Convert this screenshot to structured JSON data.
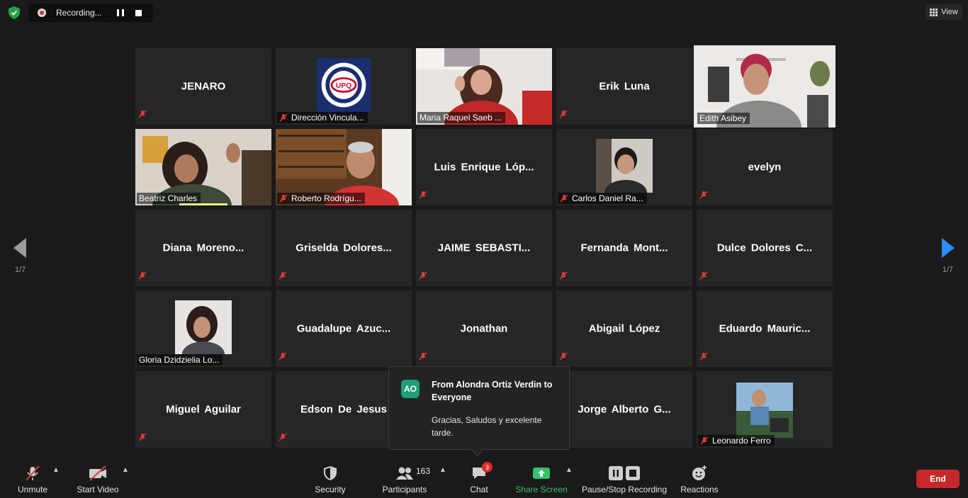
{
  "recording": {
    "label": "Recording..."
  },
  "view": {
    "label": "View"
  },
  "pagination": {
    "left": "1/7",
    "right": "1/7"
  },
  "participants": {
    "jenaro": "JENARO",
    "direccion": "Dirección Vincula...",
    "maria": "Maria Raquel Saeb ...",
    "erik": "Erik Luna",
    "edith": "Edith Asibey",
    "beatriz": "Beatriz Charles",
    "roberto": "Roberto Rodrígu...",
    "luis": "Luis Enrique Lóp...",
    "carlos": "Carlos Daniel Ra...",
    "evelyn": "evelyn",
    "diana": "Diana Moreno...",
    "griselda": "Griselda Dolores...",
    "jaime": "JAIME SEBASTI...",
    "fernanda": "Fernanda Mont...",
    "dulce": "Dulce Dolores C...",
    "gloria": "Gloria Dzidzielia Lo...",
    "guadalupe": "Guadalupe Azuc...",
    "jonathan": "Jonathan",
    "abigail": "Abigail López",
    "eduardo": "Eduardo Mauric...",
    "miguel": "Miguel Aguilar",
    "edson": "Edson De Jesus",
    "jorge": "Jorge Alberto G...",
    "leonardo": "Leonardo Ferro"
  },
  "logo": {
    "text": "UPQ"
  },
  "chat_popup": {
    "avatar": "AO",
    "from": "From Alondra Ortiz Verdin to Everyone",
    "message": "Gracias, Saludos y excelente tarde."
  },
  "toolbar": {
    "unmute": "Unmute",
    "start_video": "Start Video",
    "security": "Security",
    "participants": "Participants",
    "participant_count": "163",
    "chat": "Chat",
    "chat_badge": "3",
    "share_screen": "Share Screen",
    "pause_stop": "Pause/Stop Recording",
    "reactions": "Reactions",
    "end": "End"
  },
  "colors": {
    "active_speaker": "#e8ef88",
    "share_green": "#35c16a",
    "end_red": "#c5282d",
    "mute_red": "#e03a3a"
  }
}
